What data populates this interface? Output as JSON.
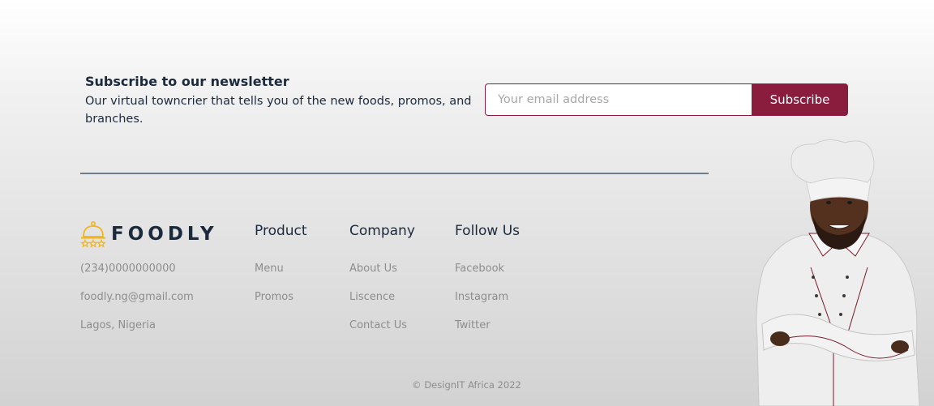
{
  "newsletter": {
    "title": "Subscribe to our newsletter",
    "description": "Our virtual towncrier that tells you of the new foods, promos, and branches.",
    "email_placeholder": "Your email address",
    "subscribe_label": "Subscribe"
  },
  "brand": {
    "name": "FOODLY",
    "phone": "(234)0000000000",
    "email": "foodly.ng@gmail.com",
    "location": "Lagos, Nigeria"
  },
  "columns": {
    "product": {
      "title": "Product",
      "links": [
        "Menu",
        "Promos"
      ]
    },
    "company": {
      "title": "Company",
      "links": [
        "About Us",
        "Liscence",
        "Contact Us"
      ]
    },
    "follow": {
      "title": "Follow Us",
      "links": [
        "Facebook",
        "Instagram",
        "Twitter"
      ]
    }
  },
  "copyright": "© DesignIT Africa 2022",
  "colors": {
    "accent": "#8a1c3d",
    "text": "#1b2a3d",
    "muted": "#8d8d8d",
    "logo": "#f2b51c"
  },
  "icons": {
    "logo": "cloche-icon"
  },
  "image": "chef-image"
}
